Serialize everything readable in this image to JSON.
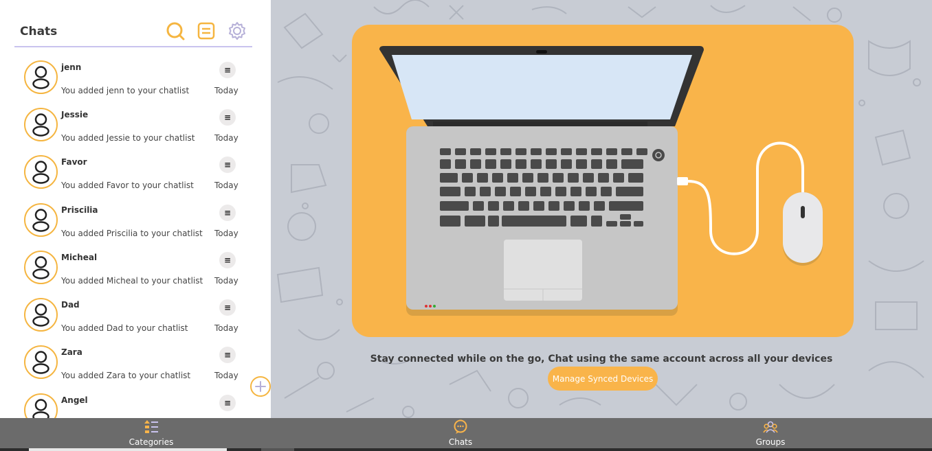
{
  "sidebar": {
    "title": "Chats",
    "header_icons": [
      "search-icon",
      "list-icon",
      "settings-icon"
    ],
    "chats": [
      {
        "name": "jenn",
        "message": "You added jenn to your chatlist",
        "time": "Today"
      },
      {
        "name": "Jessie",
        "message": "You added Jessie to your chatlist",
        "time": "Today"
      },
      {
        "name": "Favor",
        "message": "You added Favor to your chatlist",
        "time": "Today"
      },
      {
        "name": "Priscilia",
        "message": "You added Priscilia to your chatlist",
        "time": "Today"
      },
      {
        "name": "Micheal",
        "message": "You added Micheal to your chatlist",
        "time": "Today"
      },
      {
        "name": "Dad",
        "message": "You added Dad to your chatlist",
        "time": "Today"
      },
      {
        "name": "Zara",
        "message": "You added Zara to your chatlist",
        "time": "Today"
      },
      {
        "name": "Angel",
        "message": "",
        "time": ""
      }
    ],
    "menu_glyph": "≡",
    "fab_icon": "plus-icon"
  },
  "main": {
    "illustration": "laptop-with-mouse",
    "tagline": "Stay connected while on the go, Chat using the same account across all your devices",
    "manage_button": "Manage Synced Devices"
  },
  "bottom_nav": {
    "items": [
      {
        "label": "Categories",
        "icon": "categories-icon"
      },
      {
        "label": "Chats",
        "icon": "chat-bubble-icon"
      },
      {
        "label": "Groups",
        "icon": "groups-icon"
      }
    ]
  },
  "colors": {
    "accent": "#f9b44a",
    "accent_border": "#f5b540",
    "divider": "#c9c3ee",
    "nav_bg": "#6b6b6b",
    "main_bg": "#c8ccd4"
  }
}
